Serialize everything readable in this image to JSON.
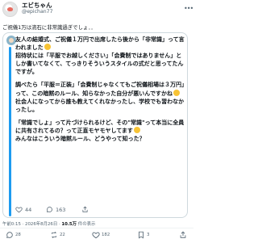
{
  "author": {
    "display_name": "エビちゃん",
    "handle": "@epichan77",
    "avatar_icon": "shrimp-avatar-icon",
    "more_icon": "more-options-icon"
  },
  "post": {
    "text": "ご祝儀1万は流石に非常識過ぎでしょ．．",
    "timestamp": "午前0:15 · 2026年8月26日",
    "views_count": "10.5万",
    "views_label": "件の表示"
  },
  "quoted": {
    "paragraphs": [
      "友人の結婚式、ご祝儀１万円で出席したら後から「非常識」って言われました",
      "招待状には「平服でお越しください」「会費制ではありません」としか書いてなくて、てっきりそういうスタイルの式だと思ってたんですが。",
      "調べたら「平服＝正装」「会費制じゃなくてもご祝儀相場は３万円」って、この暗黙のルール、知らなかった自分が悪いんですかね",
      "社会人になってから誰も教えてくれなかったし、学校でも習わなかったし。",
      "「常識でしょ」って片づけられるけど、その\"常識\"って本当に全員に共有されてるの？って正直モヤモヤしてます",
      "みんなはこういう暗黙ルール、どうやって知った？"
    ],
    "stats": {
      "likes": "44",
      "replies": "163"
    }
  },
  "actions": {
    "replies": "28",
    "reposts": "22",
    "likes": "182",
    "bookmarks": "3"
  }
}
